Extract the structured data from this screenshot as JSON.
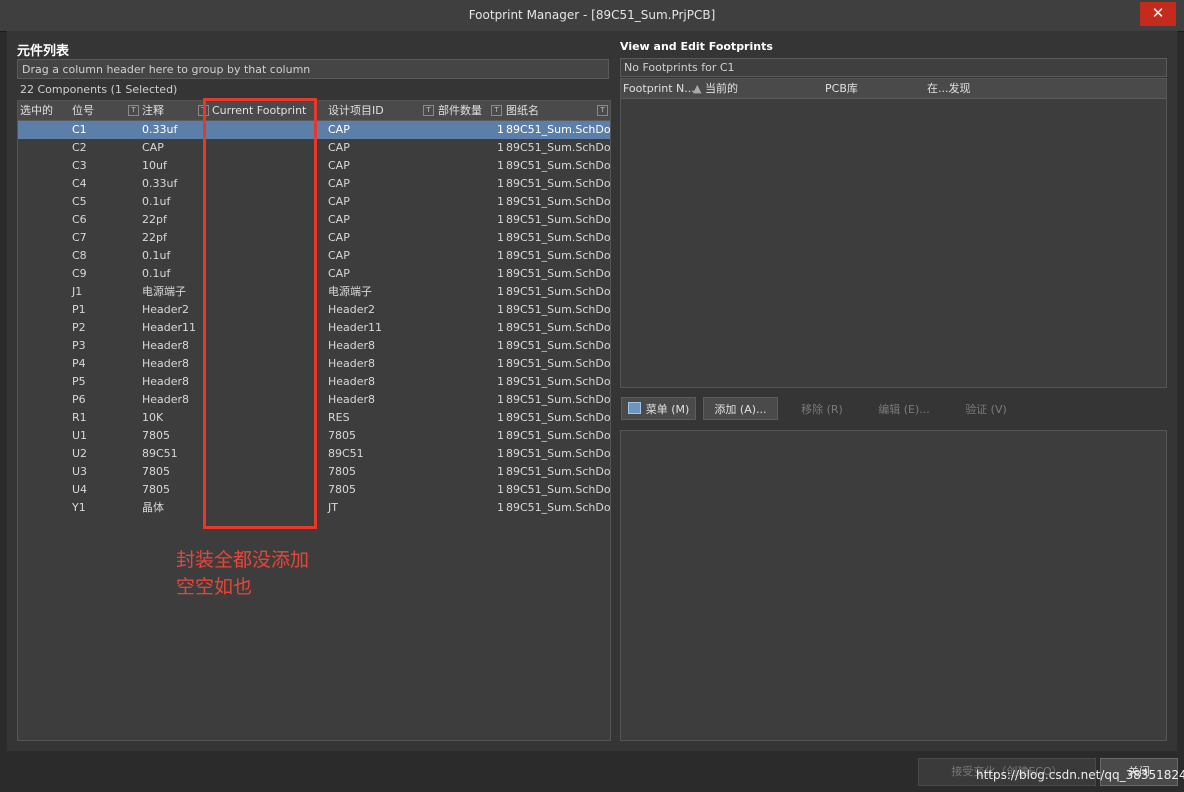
{
  "window": {
    "title": "Footprint Manager - [89C51_Sum.PrjPCB]",
    "close_glyph": "✕"
  },
  "left": {
    "section_title": "元件列表",
    "group_hint": "Drag a column header here to group by that column",
    "count_text": "22 Components (1 Selected)",
    "columns": [
      "选中的",
      "位号",
      "注释",
      "Current Footprint",
      "设计项目ID",
      "部件数量",
      "图纸名"
    ],
    "rows": [
      {
        "designator": "C1",
        "comment": "0.33uf",
        "design_id": "CAP",
        "parts": "1",
        "sheet": "89C51_Sum.SchDoc",
        "selected": true
      },
      {
        "designator": "C2",
        "comment": "CAP",
        "design_id": "CAP",
        "parts": "1",
        "sheet": "89C51_Sum.SchDoc"
      },
      {
        "designator": "C3",
        "comment": "10uf",
        "design_id": "CAP",
        "parts": "1",
        "sheet": "89C51_Sum.SchDoc"
      },
      {
        "designator": "C4",
        "comment": "0.33uf",
        "design_id": "CAP",
        "parts": "1",
        "sheet": "89C51_Sum.SchDoc"
      },
      {
        "designator": "C5",
        "comment": "0.1uf",
        "design_id": "CAP",
        "parts": "1",
        "sheet": "89C51_Sum.SchDoc"
      },
      {
        "designator": "C6",
        "comment": "22pf",
        "design_id": "CAP",
        "parts": "1",
        "sheet": "89C51_Sum.SchDoc"
      },
      {
        "designator": "C7",
        "comment": "22pf",
        "design_id": "CAP",
        "parts": "1",
        "sheet": "89C51_Sum.SchDoc"
      },
      {
        "designator": "C8",
        "comment": "0.1uf",
        "design_id": "CAP",
        "parts": "1",
        "sheet": "89C51_Sum.SchDoc"
      },
      {
        "designator": "C9",
        "comment": "0.1uf",
        "design_id": "CAP",
        "parts": "1",
        "sheet": "89C51_Sum.SchDoc"
      },
      {
        "designator": "J1",
        "comment": "电源端子",
        "design_id": "电源端子",
        "parts": "1",
        "sheet": "89C51_Sum.SchDoc"
      },
      {
        "designator": "P1",
        "comment": "Header2",
        "design_id": "Header2",
        "parts": "1",
        "sheet": "89C51_Sum.SchDoc"
      },
      {
        "designator": "P2",
        "comment": "Header11",
        "design_id": "Header11",
        "parts": "1",
        "sheet": "89C51_Sum.SchDoc"
      },
      {
        "designator": "P3",
        "comment": "Header8",
        "design_id": "Header8",
        "parts": "1",
        "sheet": "89C51_Sum.SchDoc"
      },
      {
        "designator": "P4",
        "comment": "Header8",
        "design_id": "Header8",
        "parts": "1",
        "sheet": "89C51_Sum.SchDoc"
      },
      {
        "designator": "P5",
        "comment": "Header8",
        "design_id": "Header8",
        "parts": "1",
        "sheet": "89C51_Sum.SchDoc"
      },
      {
        "designator": "P6",
        "comment": "Header8",
        "design_id": "Header8",
        "parts": "1",
        "sheet": "89C51_Sum.SchDoc"
      },
      {
        "designator": "R1",
        "comment": "10K",
        "design_id": "RES",
        "parts": "1",
        "sheet": "89C51_Sum.SchDoc"
      },
      {
        "designator": "U1",
        "comment": "7805",
        "design_id": "7805",
        "parts": "1",
        "sheet": "89C51_Sum.SchDoc"
      },
      {
        "designator": "U2",
        "comment": "89C51",
        "design_id": "89C51",
        "parts": "1",
        "sheet": "89C51_Sum.SchDoc"
      },
      {
        "designator": "U3",
        "comment": "7805",
        "design_id": "7805",
        "parts": "1",
        "sheet": "89C51_Sum.SchDoc"
      },
      {
        "designator": "U4",
        "comment": "7805",
        "design_id": "7805",
        "parts": "1",
        "sheet": "89C51_Sum.SchDoc"
      },
      {
        "designator": "Y1",
        "comment": "晶体",
        "design_id": "JT",
        "parts": "1",
        "sheet": "89C51_Sum.SchDoc"
      }
    ],
    "annotation": {
      "line1": "封装全都没添加",
      "line2": "空空如也"
    }
  },
  "right": {
    "section_title": "View and Edit Footprints",
    "no_footprints": "No Footprints for C1",
    "columns": [
      "Footprint N...",
      "当前的",
      "PCB库",
      "在...发现"
    ],
    "buttons": {
      "menu": "菜单 (M)",
      "add": "添加 (A)...",
      "remove": "移除 (R)",
      "edit": "编辑 (E)...",
      "validate": "验证 (V)"
    }
  },
  "footer": {
    "accept": "接受变化（创建ECO）",
    "close": "关闭",
    "watermark": "https://blog.csdn.net/qq_38351824"
  },
  "colors": {
    "selection": "#5b7fa8",
    "annotation_red": "#e8372b"
  }
}
